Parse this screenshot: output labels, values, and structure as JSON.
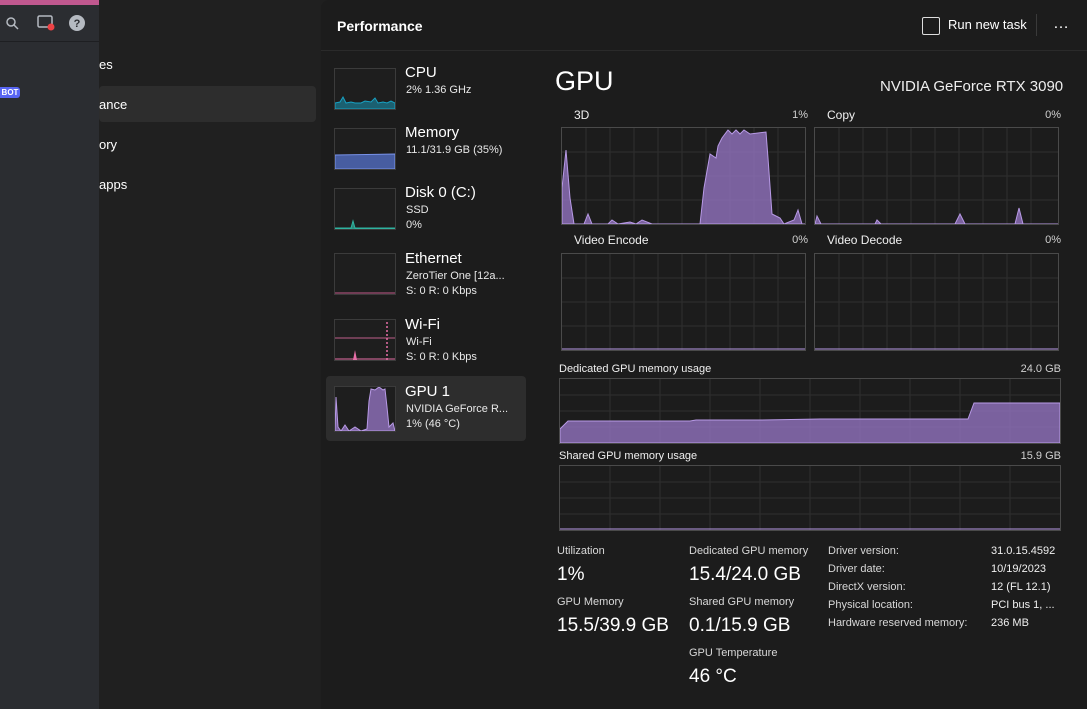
{
  "left_panel": {
    "icons": [
      "search-icon",
      "screen-share-icon",
      "help-icon"
    ],
    "badge": "BOT"
  },
  "nav": {
    "items": [
      {
        "label": "es"
      },
      {
        "label": "ance"
      },
      {
        "label": "ory"
      },
      {
        "label": "apps"
      }
    ]
  },
  "header": {
    "title": "Performance",
    "run_task_label": "Run new task",
    "more_label": "…"
  },
  "devices": [
    {
      "name": "CPU",
      "line1": "2%  1.36 GHz",
      "line2": "",
      "color": "#17a2c4"
    },
    {
      "name": "Memory",
      "line1": "11.1/31.9 GB (35%)",
      "line2": "",
      "color": "#5978d9"
    },
    {
      "name": "Disk 0 (C:)",
      "line1": "SSD",
      "line2": "0%",
      "color": "#2fb3a0"
    },
    {
      "name": "Ethernet",
      "line1": "ZeroTier One [12a...",
      "line2": "S: 0 R: 0 Kbps",
      "color": "#c25a8a"
    },
    {
      "name": "Wi-Fi",
      "line1": "Wi-Fi",
      "line2": "S: 0 R: 0 Kbps",
      "color": "#e76fa7"
    },
    {
      "name": "GPU 1",
      "line1": "NVIDIA GeForce R...",
      "line2": "1%  (46 °C)",
      "color": "#9a78c9"
    }
  ],
  "gpu": {
    "title": "GPU",
    "model": "NVIDIA GeForce RTX 3090",
    "engines": [
      {
        "label": "3D",
        "pct": "1%"
      },
      {
        "label": "Copy",
        "pct": "0%"
      },
      {
        "label": "Video Encode",
        "pct": "0%"
      },
      {
        "label": "Video Decode",
        "pct": "0%"
      }
    ],
    "dedicated_label": "Dedicated GPU memory usage",
    "dedicated_max": "24.0 GB",
    "shared_label": "Shared GPU memory usage",
    "shared_max": "15.9 GB",
    "stats": {
      "utilization_label": "Utilization",
      "utilization": "1%",
      "gpu_memory_label": "GPU Memory",
      "gpu_memory": "15.5/39.9 GB",
      "dedicated_label": "Dedicated GPU memory",
      "dedicated": "15.4/24.0 GB",
      "shared_label": "Shared GPU memory",
      "shared": "0.1/15.9 GB",
      "temp_label": "GPU Temperature",
      "temp": "46 °C"
    },
    "info": [
      {
        "k": "Driver version:",
        "v": "31.0.15.4592"
      },
      {
        "k": "Driver date:",
        "v": "10/19/2023"
      },
      {
        "k": "DirectX version:",
        "v": "12 (FL 12.1)"
      },
      {
        "k": "Physical location:",
        "v": "PCI bus 1, ..."
      },
      {
        "k": "Hardware reserved memory:",
        "v": "236 MB"
      }
    ]
  }
}
